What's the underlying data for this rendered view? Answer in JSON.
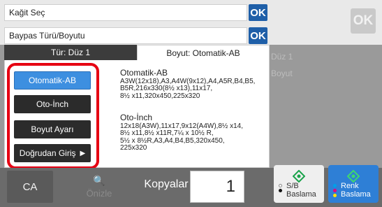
{
  "dialog": {
    "title": "Kağit Seç",
    "ok_label": "OK",
    "bypass_label": "Baypas Türü/Boyutu",
    "tab_type": "Tür:   Düz 1",
    "tab_size": "Boyut:   Otomatik-AB"
  },
  "size_buttons": [
    {
      "label": "Otomatik-AB",
      "selected": true
    },
    {
      "label": "Oto-İnch"
    },
    {
      "label": "Boyut Ayarı"
    },
    {
      "label": "Doğrudan Giriş",
      "icon": "arrow-right-icon"
    }
  ],
  "size_info": [
    {
      "heading": "Otomatik-AB",
      "lines": [
        "A3W(12x18),A3,A4W(9x12),A4,A5R,B4,B5,",
        "B5R,216x330(8½ x13),11x17,",
        "8½ x11,320x450,225x320"
      ]
    },
    {
      "heading": "Oto-İnch",
      "lines": [
        "12x18(A3W),11x17,9x12(A4W),8½ x14,",
        "8½ x11,8½ x11R,7¼ x 10½ R,",
        "5½ x 8½R,A3,A4,B4,B5,320x450,",
        "225x320"
      ]
    }
  ],
  "background": {
    "ok_label": "OK",
    "row1": "Düz 1",
    "row2": "Boyut"
  },
  "bottom_bar": {
    "ca_label": "CA",
    "preview_label": "Önizle",
    "copies_label": "Kopyalar",
    "copies_value": "1",
    "start_bw_label": [
      "S/B",
      "Baslama"
    ],
    "start_color_label": [
      "Renk",
      "Baslama"
    ]
  },
  "colors": {
    "accent": "#1f5fa8",
    "selected": "#3d8fe0",
    "highlight": "#e60012",
    "start_color": "#2e7fd6",
    "start_diamond": "#19a34a"
  }
}
